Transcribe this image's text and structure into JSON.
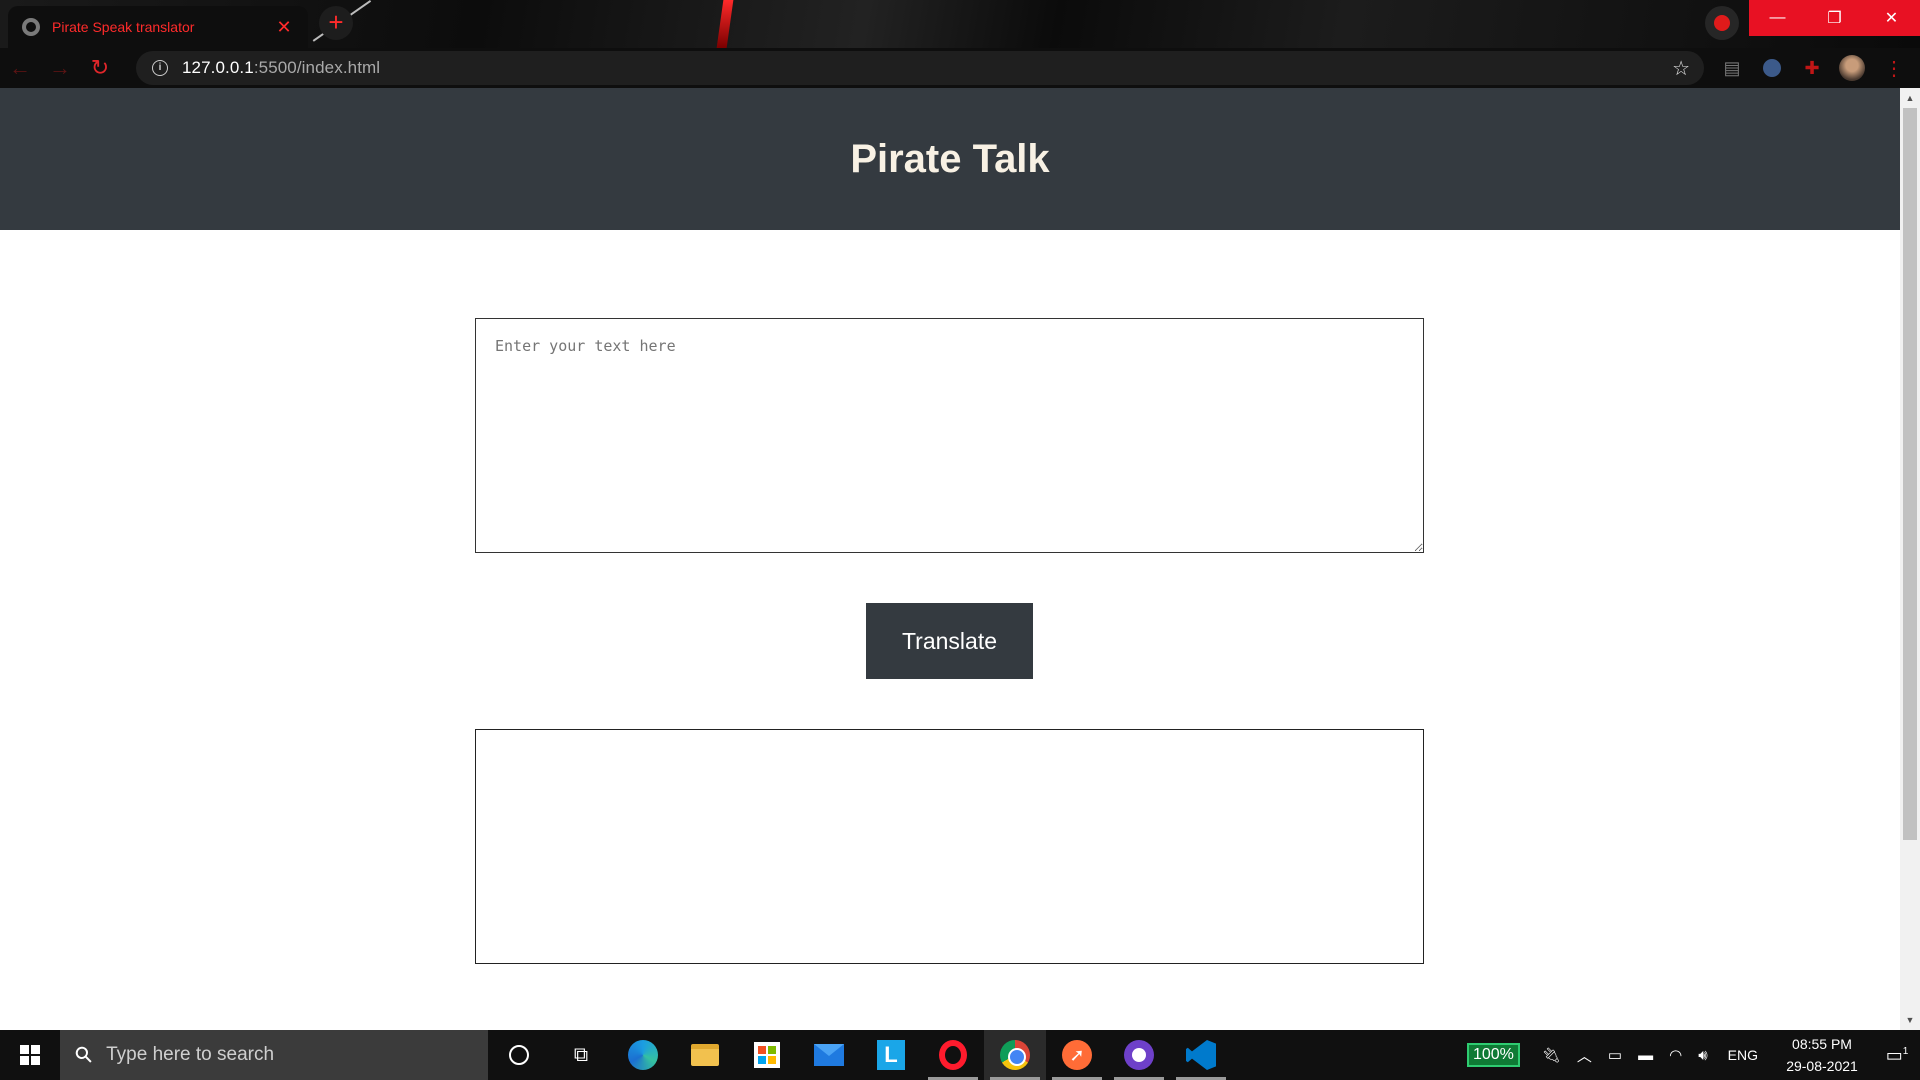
{
  "browser": {
    "tab_title": "Pirate Speak translator",
    "tab_close": "✕",
    "new_tab": "+",
    "url_host": "127.0.0.1",
    "url_path": ":5500/index.html",
    "window_controls": {
      "minimize": "—",
      "restore": "❐",
      "close": "✕"
    },
    "nav": {
      "back": "←",
      "forward": "→",
      "reload": "↻"
    }
  },
  "page": {
    "title": "Pirate Talk",
    "input_placeholder": "Enter your text here",
    "input_value": "",
    "translate_label": "Translate",
    "output_text": ""
  },
  "taskbar": {
    "search_placeholder": "Type here to search",
    "apps": [
      "cortana",
      "task-view",
      "edge",
      "file-explorer",
      "microsoft-store",
      "mail",
      "l-app",
      "opera",
      "chrome",
      "postman",
      "github-desktop",
      "vscode"
    ],
    "battery": "100%",
    "language": "ENG",
    "time": "08:55 PM",
    "date": "29-08-2021",
    "notification_count": "1"
  },
  "colors": {
    "header_bg": "#343a40",
    "title_color": "#f8f1e4",
    "button_bg": "#343a40",
    "browser_accent": "#ff2b2b"
  }
}
